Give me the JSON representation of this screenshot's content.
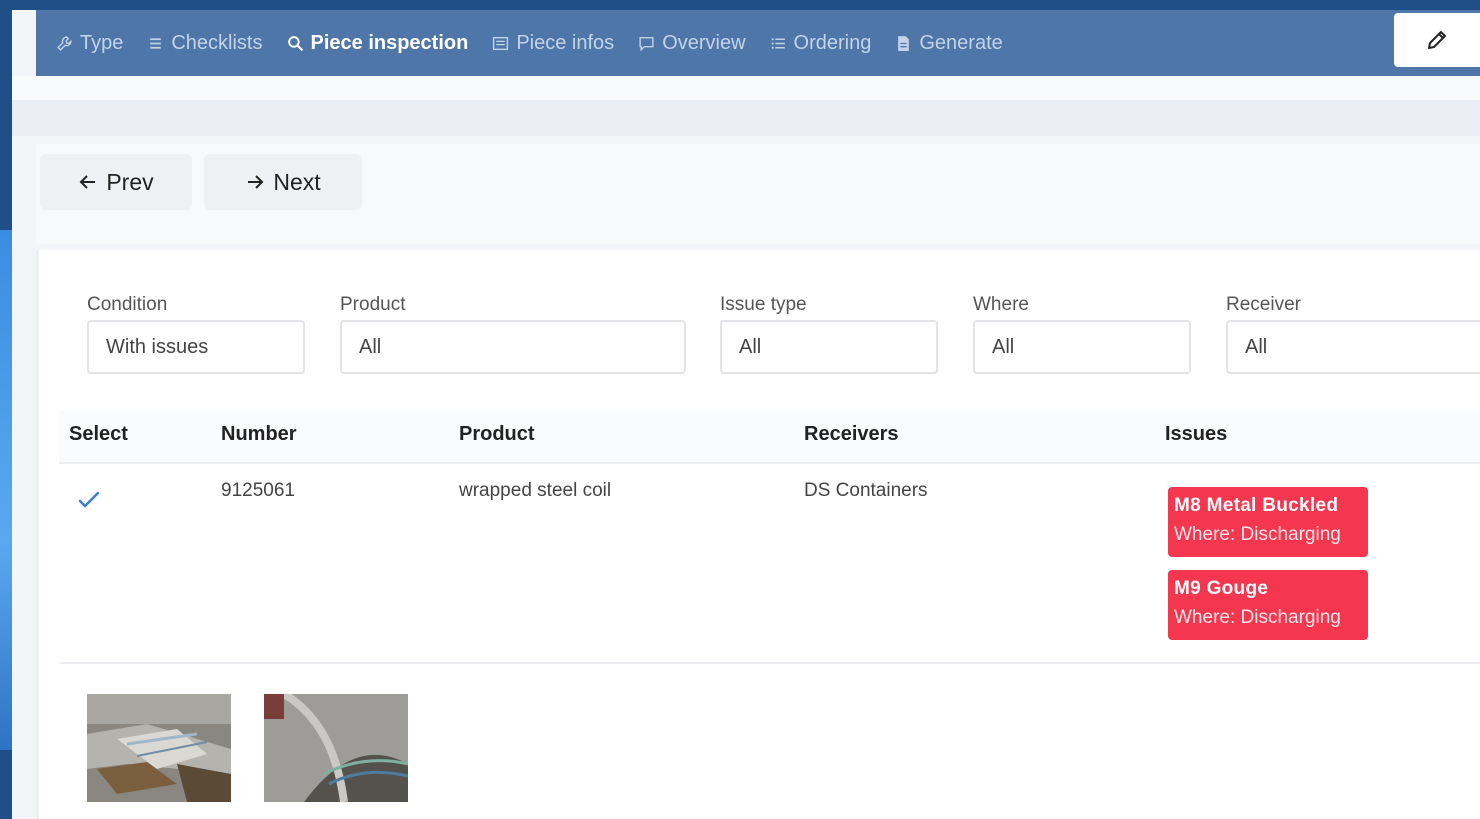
{
  "nav": {
    "items": [
      {
        "label": "Type",
        "icon": "wrench-icon"
      },
      {
        "label": "Checklists",
        "icon": "list-icon"
      },
      {
        "label": "Piece inspection",
        "icon": "search-icon",
        "active": true
      },
      {
        "label": "Piece infos",
        "icon": "card-icon"
      },
      {
        "label": "Overview",
        "icon": "comment-icon"
      },
      {
        "label": "Ordering",
        "icon": "list-ordered-icon"
      },
      {
        "label": "Generate",
        "icon": "file-icon"
      }
    ],
    "edit_icon": "pencil-icon",
    "active_color": "#ffffff",
    "bar_color": "#4e76a8"
  },
  "pager": {
    "prev_label": "Prev",
    "next_label": "Next"
  },
  "filters": {
    "condition": {
      "label": "Condition",
      "value": "With issues"
    },
    "product": {
      "label": "Product",
      "value": "All"
    },
    "issue_type": {
      "label": "Issue type",
      "value": "All"
    },
    "where": {
      "label": "Where",
      "value": "All"
    },
    "receiver": {
      "label": "Receiver",
      "value": "All"
    }
  },
  "table": {
    "headers": {
      "select": "Select",
      "number": "Number",
      "product": "Product",
      "receivers": "Receivers",
      "issues": "Issues"
    },
    "rows": [
      {
        "selected": true,
        "number": "9125061",
        "product": "wrapped steel coil",
        "receivers": "DS Containers",
        "issues": [
          {
            "name": "M8 Metal Buckled",
            "where": "Where: Discharging"
          },
          {
            "name": "M9 Gouge",
            "where": "Where: Discharging"
          }
        ]
      }
    ]
  },
  "colors": {
    "issue_badge": "#f4364e",
    "check": "#3a7bd5"
  }
}
